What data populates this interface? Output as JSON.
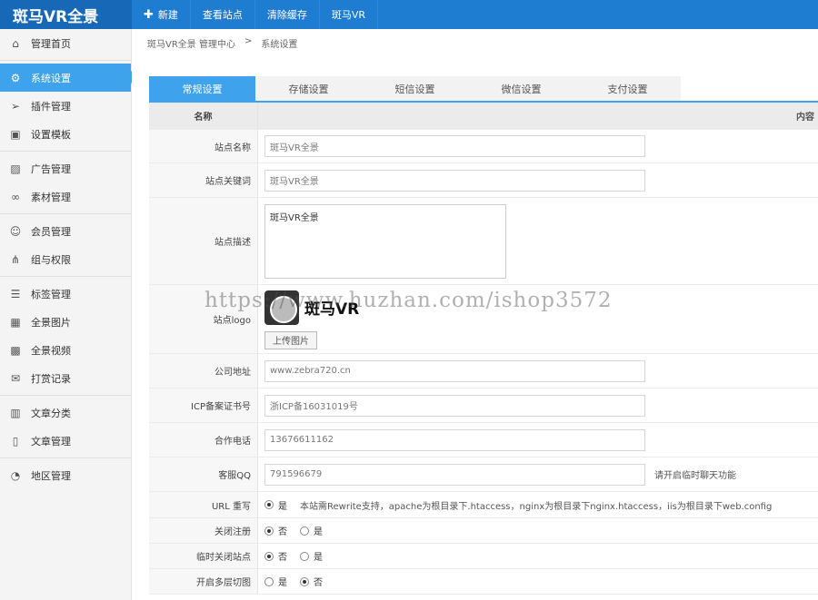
{
  "brand": "斑马VR全景",
  "topnav": [
    {
      "label": "新建",
      "plus": "✚"
    },
    {
      "label": "查看站点"
    },
    {
      "label": "清除缓存"
    },
    {
      "label": "斑马VR"
    }
  ],
  "sidebar": [
    {
      "label": "管理首页",
      "icon": "home-icon",
      "glyph": "⌂"
    },
    {
      "label": "系统设置",
      "icon": "gear-icon",
      "glyph": "⚙",
      "active": true
    },
    {
      "label": "插件管理",
      "icon": "send-icon",
      "glyph": "➢"
    },
    {
      "label": "设置模板",
      "icon": "template-icon",
      "glyph": "▣"
    },
    {
      "label": "广告管理",
      "icon": "image-icon",
      "glyph": "▨"
    },
    {
      "label": "素材管理",
      "icon": "link-icon",
      "glyph": "∞"
    },
    {
      "label": "会员管理",
      "icon": "users-icon",
      "glyph": "☺"
    },
    {
      "label": "组与权限",
      "icon": "share-icon",
      "glyph": "⋔"
    },
    {
      "label": "标签管理",
      "icon": "list-icon",
      "glyph": "☰"
    },
    {
      "label": "全景图片",
      "icon": "grid-icon",
      "glyph": "▦"
    },
    {
      "label": "全景视频",
      "icon": "apps-icon",
      "glyph": "▩"
    },
    {
      "label": "打赏记录",
      "icon": "gift-icon",
      "glyph": "✉"
    },
    {
      "label": "文章分类",
      "icon": "book-icon",
      "glyph": "▥"
    },
    {
      "label": "文章管理",
      "icon": "file-icon",
      "glyph": "▯"
    },
    {
      "label": "地区管理",
      "icon": "palette-icon",
      "glyph": "◔"
    }
  ],
  "breadcrumb": {
    "root": "斑马VR全景 管理中心",
    "sep": ">",
    "current": "系统设置"
  },
  "tabs": [
    "常规设置",
    "存储设置",
    "短信设置",
    "微信设置",
    "支付设置"
  ],
  "table": {
    "header_name": "名称",
    "header_content": "内容",
    "site_name": {
      "label": "站点名称",
      "value": "斑马VR全景"
    },
    "keywords": {
      "label": "站点关键词",
      "value": "斑马VR全景"
    },
    "description": {
      "label": "站点描述",
      "value": "斑马VR全景"
    },
    "logo": {
      "label": "站点logo",
      "logo_text": "斑马VR",
      "upload_label": "上传图片"
    },
    "address": {
      "label": "公司地址",
      "value": "www.zebra720.cn"
    },
    "icp": {
      "label": "ICP备案证书号",
      "value": "浙ICP备16031019号"
    },
    "phone": {
      "label": "合作电话",
      "value": "13676611162"
    },
    "qq": {
      "label": "客服QQ",
      "value": "791596679",
      "hint": "请开启临时聊天功能"
    },
    "rewrite": {
      "label": "URL 重写",
      "opt_yes": "是",
      "hint": "本站需Rewrite支持，apache为根目录下.htaccess，nginx为根目录下nginx.htaccess，iis为根目录下web.config"
    },
    "close_register": {
      "label": "关闭注册",
      "opt_no": "否",
      "opt_yes": "是"
    },
    "close_site": {
      "label": "临时关闭站点",
      "opt_no": "否",
      "opt_yes": "是"
    },
    "multi_level": {
      "label": "开启多层切图",
      "opt_yes": "是",
      "opt_no": "否"
    }
  },
  "watermark": "https://www.huzhan.com/ishop3572"
}
